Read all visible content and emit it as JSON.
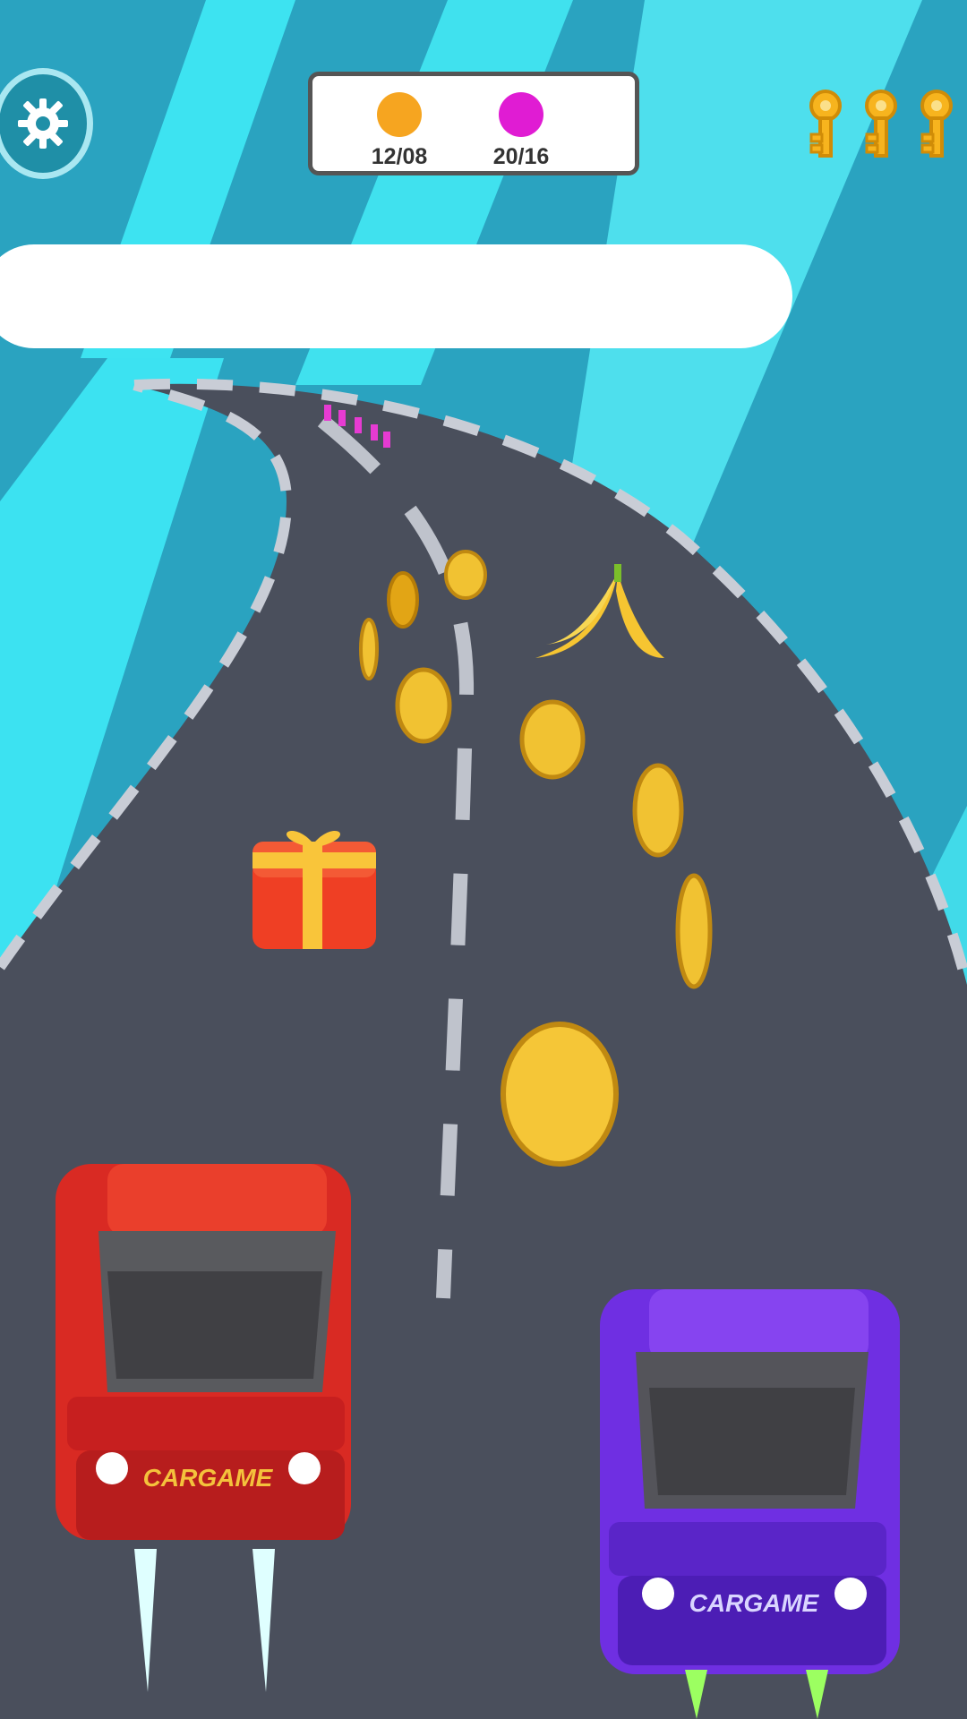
{
  "hud": {
    "settings_icon": "gear-icon",
    "player1": {
      "color": "#f6a520",
      "score": "12/08"
    },
    "player2": {
      "color": "#e01cd3",
      "score": "20/16"
    },
    "keys": {
      "count": 3,
      "icon": "key-icon",
      "color": "#f7b41e"
    },
    "progress": {
      "value": 0
    }
  },
  "cars": [
    {
      "name": "red-car",
      "color": "#e22d24",
      "plate": "CARGAME"
    },
    {
      "name": "purple-car",
      "color": "#7b3be8",
      "plate": "CARGAME"
    }
  ],
  "pickups": {
    "coin_icon": "coin-icon",
    "gift_icon": "gift-box-icon",
    "hazard_icon": "banana-peel-icon"
  }
}
